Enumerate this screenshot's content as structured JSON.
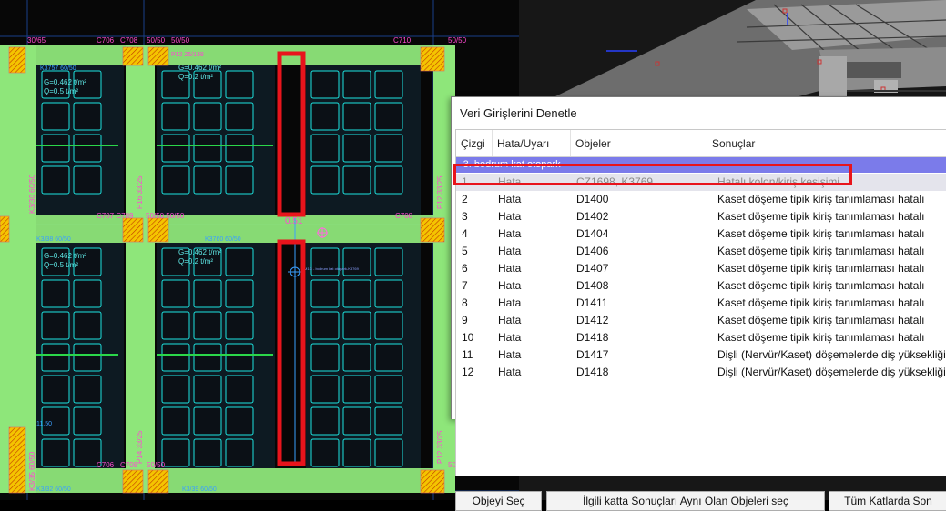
{
  "cad": {
    "labels_top": [
      "30/65",
      "C706",
      "C708",
      "50/50",
      "50/50",
      "P12 25/138",
      "C710",
      "50/50"
    ],
    "labels_mid": [
      "C707 C709",
      "C711",
      "50/50 50/50",
      "C708"
    ],
    "labels_bottom": [
      "C706",
      "C708",
      "50/50",
      "50/50"
    ],
    "vertical_labels": [
      "K3/30 60/50",
      "P16 33/25",
      "P12 33/25",
      "K3/35 60/50",
      "P14 33/25",
      "P12 33/25"
    ],
    "load_text_1a": "G=0.462 t/m²",
    "load_text_1b": "Q=0.5 t/m²",
    "load_text_2a": "G=0.462 t/m²",
    "load_text_2b": "Q=0.2 t/m²",
    "load_text_3a": "G=0.462 t/m²",
    "load_text_3b": "Q=0.5 t/m²",
    "load_text_4a": "G=0.462 t/m²",
    "load_text_4b": "Q=0.2 t/m²",
    "beam_label_1": "K3757 60/50",
    "beam_label_2": "K3/38 60/50",
    "beam_label_3": "K3760 60/50",
    "beam_label_4": "K3/32 60/50",
    "beam_label_5": "K3/39 60/50",
    "beam_label_6": "K3/30 60/50",
    "section_label": "0.51",
    "small_note": "M1:3 - bodrum kat otopark-K3769",
    "level_mark": "11.50",
    "highlight_color": "#e8141c",
    "slab_fill": "#8ee67a",
    "grid_line_color": "#1de3e0"
  },
  "dialog": {
    "title": "Veri Girişlerini Denetle",
    "columns": [
      "Çizgi",
      "Hata/Uyarı",
      "Objeler",
      "Sonuçlar"
    ],
    "group": "-3. bodrum kat otopark",
    "rows": [
      {
        "n": "1",
        "type": "Hata",
        "obj": "CZ1698, K3769",
        "result": "Hatalı kolon/kiriş kesişimi"
      },
      {
        "n": "2",
        "type": "Hata",
        "obj": "D1400",
        "result": "Kaset döşeme tipik kiriş tanımlaması hatalı"
      },
      {
        "n": "3",
        "type": "Hata",
        "obj": "D1402",
        "result": "Kaset döşeme tipik kiriş tanımlaması hatalı"
      },
      {
        "n": "4",
        "type": "Hata",
        "obj": "D1404",
        "result": "Kaset döşeme tipik kiriş tanımlaması hatalı"
      },
      {
        "n": "5",
        "type": "Hata",
        "obj": "D1406",
        "result": "Kaset döşeme tipik kiriş tanımlaması hatalı"
      },
      {
        "n": "6",
        "type": "Hata",
        "obj": "D1407",
        "result": "Kaset döşeme tipik kiriş tanımlaması hatalı"
      },
      {
        "n": "7",
        "type": "Hata",
        "obj": "D1408",
        "result": "Kaset döşeme tipik kiriş tanımlaması hatalı"
      },
      {
        "n": "8",
        "type": "Hata",
        "obj": "D1411",
        "result": "Kaset döşeme tipik kiriş tanımlaması hatalı"
      },
      {
        "n": "9",
        "type": "Hata",
        "obj": "D1412",
        "result": "Kaset döşeme tipik kiriş tanımlaması hatalı"
      },
      {
        "n": "10",
        "type": "Hata",
        "obj": "D1418",
        "result": "Kaset döşeme tipik kiriş tanımlaması hatalı"
      },
      {
        "n": "11",
        "type": "Hata",
        "obj": "D1417",
        "result": "Dişli (Nervür/Kaset) döşemelerde diş yüksekliği şartı sag"
      },
      {
        "n": "12",
        "type": "Hata",
        "obj": "D1418",
        "result": "Dişli (Nervür/Kaset) döşemelerde diş yüksekliği şartı sag"
      }
    ],
    "buttons": {
      "select_object": "Objeyi Seç",
      "select_same_floor": "İlgili katta Sonuçları Aynı Olan Objeleri seç",
      "all_floors": "Tüm Katlarda Son"
    },
    "group_color": "#7b7bea"
  }
}
